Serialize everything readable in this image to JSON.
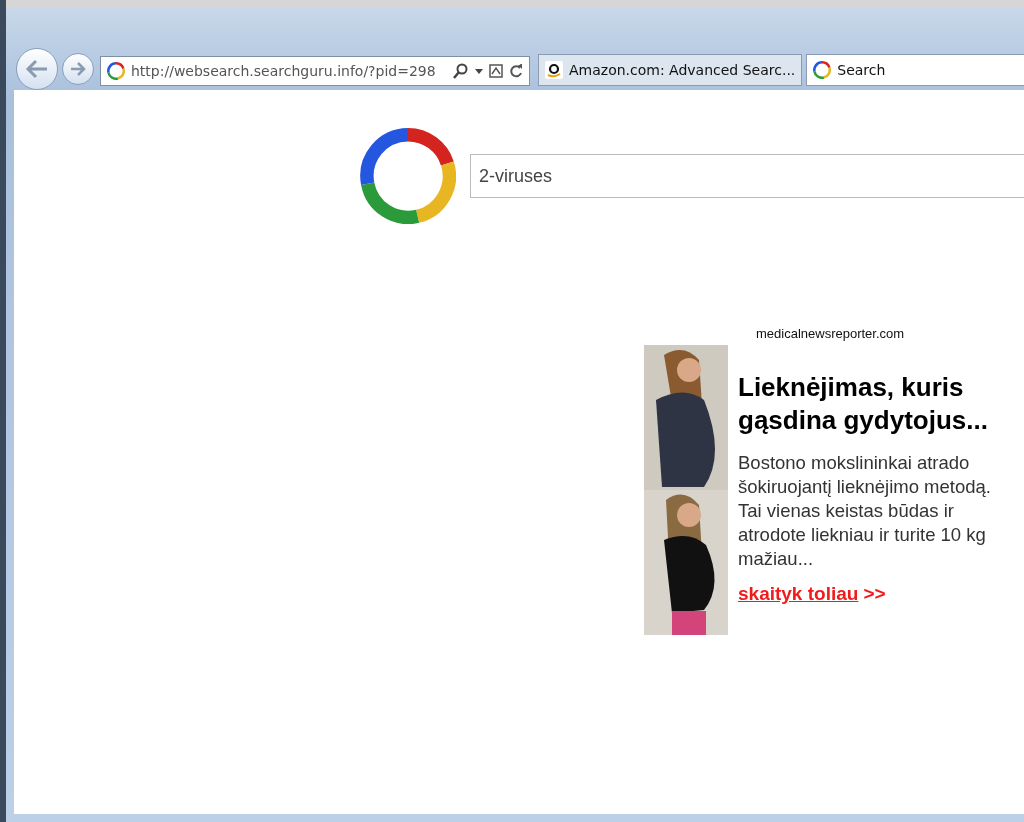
{
  "address_bar": {
    "url": "http://websearch.searchguru.info/?pid=298"
  },
  "tabs": [
    {
      "label": "Amazon.com: Advanced Searc...",
      "kind": "amazon",
      "selected": false
    },
    {
      "label": "Search",
      "kind": "ring",
      "selected": true
    }
  ],
  "search": {
    "value": "2-viruses"
  },
  "ad": {
    "source": "medicalnewsreporter.com",
    "title": "Lieknėjimas, kuris gąsdina gydytojus...",
    "body": "Bostono mokslininkai atrado šokiruojantį lieknėjimo metodą. Tai vienas keistas būdas ir atrodote liekniau ir turite 10 kg mažiau...",
    "link": "skaityk toliau",
    "link_suffix": ">>"
  }
}
